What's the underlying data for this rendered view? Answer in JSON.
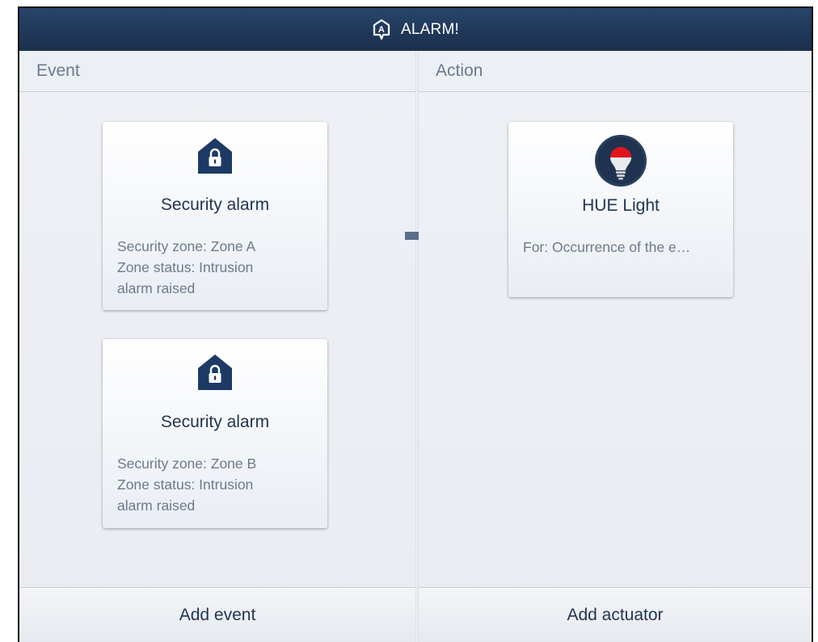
{
  "window": {
    "title": "ALARM!",
    "icon": "alarm-badge-icon"
  },
  "event_column": {
    "header": "Event",
    "footer_button": "Add event",
    "cards": [
      {
        "icon": "house-lock-icon",
        "title": "Security alarm",
        "details": [
          "Security zone: Zone A",
          "Zone status: Intrusion",
          "alarm raised"
        ]
      },
      {
        "icon": "house-lock-icon",
        "title": "Security alarm",
        "details": [
          "Security zone: Zone B",
          "Zone status: Intrusion",
          "alarm raised"
        ]
      }
    ]
  },
  "connector": {
    "icon": "arrow-right-icon"
  },
  "action_column": {
    "header": "Action",
    "footer_button": "Add actuator",
    "cards": [
      {
        "icon": "light-bulb-icon",
        "title": "HUE Light",
        "details": [
          "For: Occurrence of the e…"
        ]
      }
    ]
  },
  "colors": {
    "titlebar": "#1f3a5c",
    "icon_navy": "#1d3a66",
    "bulb_red": "#e0151b",
    "text_dark": "#1f3552",
    "text_muted": "#6d7a8c"
  }
}
